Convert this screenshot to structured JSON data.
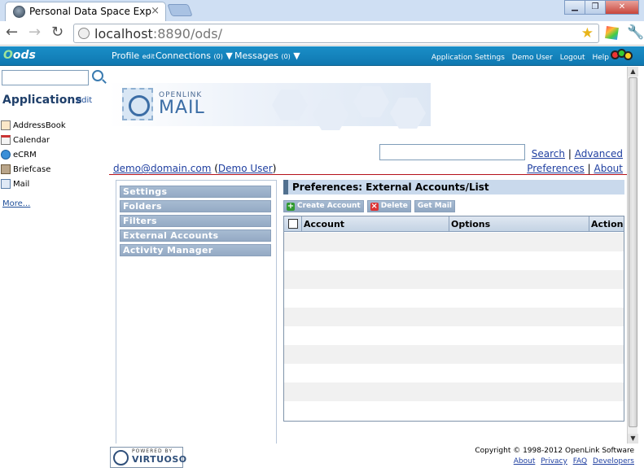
{
  "browser": {
    "tab_title": "Personal Data Space Expl",
    "tab_close": "×",
    "url_host": "localhost",
    "url_rest": ":8890/ods/",
    "window_buttons": [
      "▁",
      "❐",
      "✕"
    ]
  },
  "ods_header": {
    "logo_o": "O",
    "logo_rest": "ods",
    "profile": "Profile",
    "profile_edit": "edit",
    "connections": "Connections",
    "connections_count": "(0)",
    "messages": "Messages",
    "messages_count": "(0)",
    "right_links": [
      "Application Settings",
      "Demo User",
      "Logout",
      "Help"
    ]
  },
  "sidebar": {
    "search_placeholder": "",
    "title": "Applications",
    "edit": "edit",
    "apps": [
      {
        "label": "AddressBook",
        "icon": "addressbook-icon"
      },
      {
        "label": "Calendar",
        "icon": "calendar-icon"
      },
      {
        "label": "eCRM",
        "icon": "ecrm-icon"
      },
      {
        "label": "Briefcase",
        "icon": "briefcase-icon"
      },
      {
        "label": "Mail",
        "icon": "mail-icon"
      }
    ],
    "more": "More..."
  },
  "banner": {
    "brand_top": "OPENLINK",
    "brand_main": "MAIL"
  },
  "search": {
    "value": "",
    "search_link": "Search",
    "sep": "|",
    "advanced_link": "Advanced"
  },
  "user_row": {
    "email": "demo@domain.com",
    "name": "Demo User",
    "preferences": "Preferences",
    "about": "About"
  },
  "prefs_nav": [
    "Settings",
    "Folders",
    "Filters",
    "External Accounts",
    "Activity Manager"
  ],
  "panel": {
    "title": "Preferences: External Accounts/List",
    "actions": [
      "Create Account",
      "Delete",
      "Get Mail"
    ],
    "columns": [
      "Account",
      "Options",
      "Action"
    ]
  },
  "footer": {
    "powered_by": "POWERED BY",
    "virtuoso": "VIRTUOSO",
    "copyright": "Copyright © 1998-2012 OpenLink Software",
    "links": [
      "About",
      "Privacy",
      "FAQ",
      "Developers"
    ]
  }
}
